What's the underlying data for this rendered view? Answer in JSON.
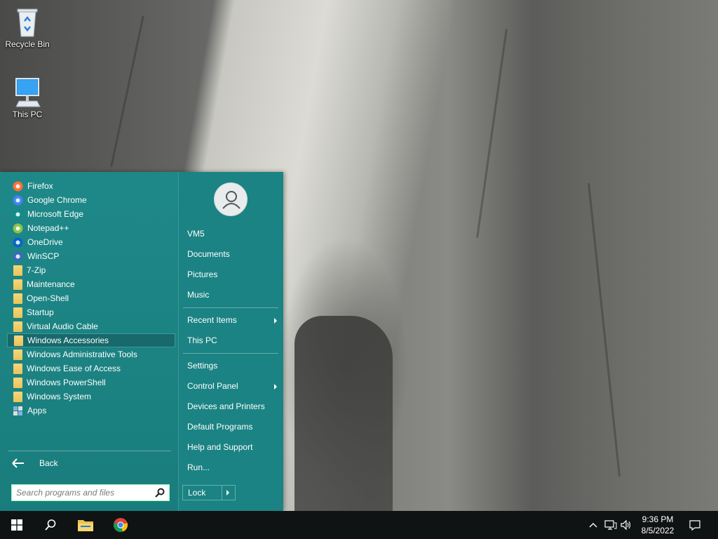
{
  "desktop": {
    "icons": [
      {
        "label": "Recycle Bin",
        "icon": "recycle-bin-icon"
      },
      {
        "label": "This PC",
        "icon": "computer-icon"
      }
    ]
  },
  "start_menu": {
    "programs": [
      {
        "label": "Firefox",
        "icon": "firefox-icon",
        "color": "#ff7139"
      },
      {
        "label": "Google Chrome",
        "icon": "chrome-icon",
        "color": "#4285f4"
      },
      {
        "label": "Microsoft Edge",
        "icon": "edge-icon",
        "color": "#0c8f8a"
      },
      {
        "label": "Notepad++",
        "icon": "notepadpp-icon",
        "color": "#8bc34a"
      },
      {
        "label": "OneDrive",
        "icon": "onedrive-icon",
        "color": "#0a64c8"
      },
      {
        "label": "WinSCP",
        "icon": "winscp-icon",
        "color": "#3a6bb5"
      },
      {
        "label": "7-Zip",
        "icon": "folder-icon"
      },
      {
        "label": "Maintenance",
        "icon": "folder-icon"
      },
      {
        "label": "Open-Shell",
        "icon": "folder-icon"
      },
      {
        "label": "Startup",
        "icon": "folder-icon"
      },
      {
        "label": "Virtual Audio Cable",
        "icon": "folder-icon"
      },
      {
        "label": "Windows Accessories",
        "icon": "folder-icon",
        "selected": true
      },
      {
        "label": "Windows Administrative Tools",
        "icon": "folder-icon"
      },
      {
        "label": "Windows Ease of Access",
        "icon": "folder-icon"
      },
      {
        "label": "Windows PowerShell",
        "icon": "folder-icon"
      },
      {
        "label": "Windows System",
        "icon": "folder-icon"
      },
      {
        "label": "Apps",
        "icon": "apps-icon"
      }
    ],
    "back_label": "Back",
    "search_placeholder": "Search programs and files",
    "right": {
      "user": "VM5",
      "documents": "Documents",
      "pictures": "Pictures",
      "music": "Music",
      "recent_items": "Recent Items",
      "this_pc": "This PC",
      "settings": "Settings",
      "control_panel": "Control Panel",
      "devices_printers": "Devices and Printers",
      "default_programs": "Default Programs",
      "help_support": "Help and Support",
      "run": "Run...",
      "lock": "Lock"
    },
    "accent": "#1e8888"
  },
  "taskbar": {
    "time": "9:36 PM",
    "date": "8/5/2022"
  }
}
